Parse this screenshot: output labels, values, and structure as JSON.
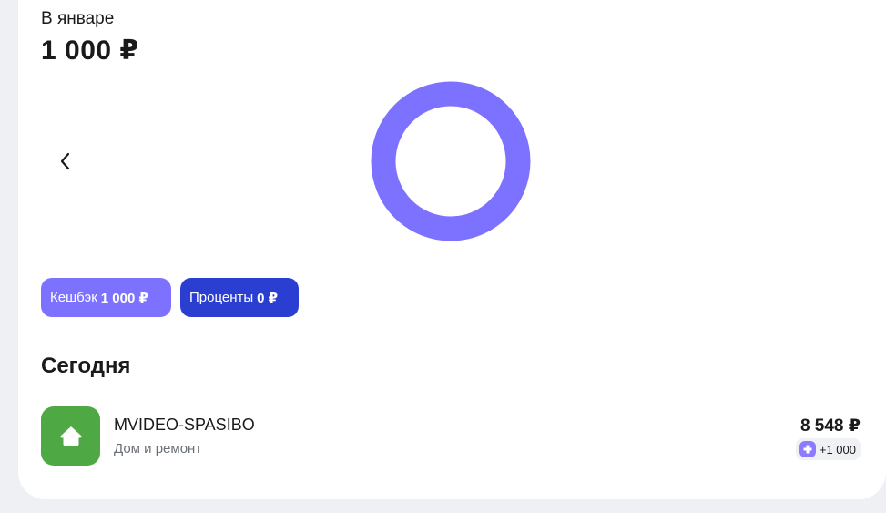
{
  "summary": {
    "month_label": "В январе",
    "total": "1 000 ₽"
  },
  "chart_data": {
    "type": "pie",
    "categories": [
      "Кешбэк",
      "Проценты"
    ],
    "values": [
      1000,
      0
    ],
    "colors": [
      "#7d72ff",
      "#2a3fd1"
    ]
  },
  "filters": {
    "cashback": {
      "label": "Кешбэк",
      "value": "1 000 ₽"
    },
    "interest": {
      "label": "Проценты",
      "value": "0 ₽"
    }
  },
  "section": {
    "title": "Сегодня"
  },
  "transactions": [
    {
      "name": "MVIDEO-SPASIBO",
      "category": "Дом и ремонт",
      "amount": "8 548 ₽",
      "bonus": "+1 000",
      "icon": "house-icon",
      "icon_color": "#4ea843"
    }
  ],
  "icons": {
    "prev": "chevron-left-icon",
    "bonus": "spasibo-bonus-icon"
  }
}
